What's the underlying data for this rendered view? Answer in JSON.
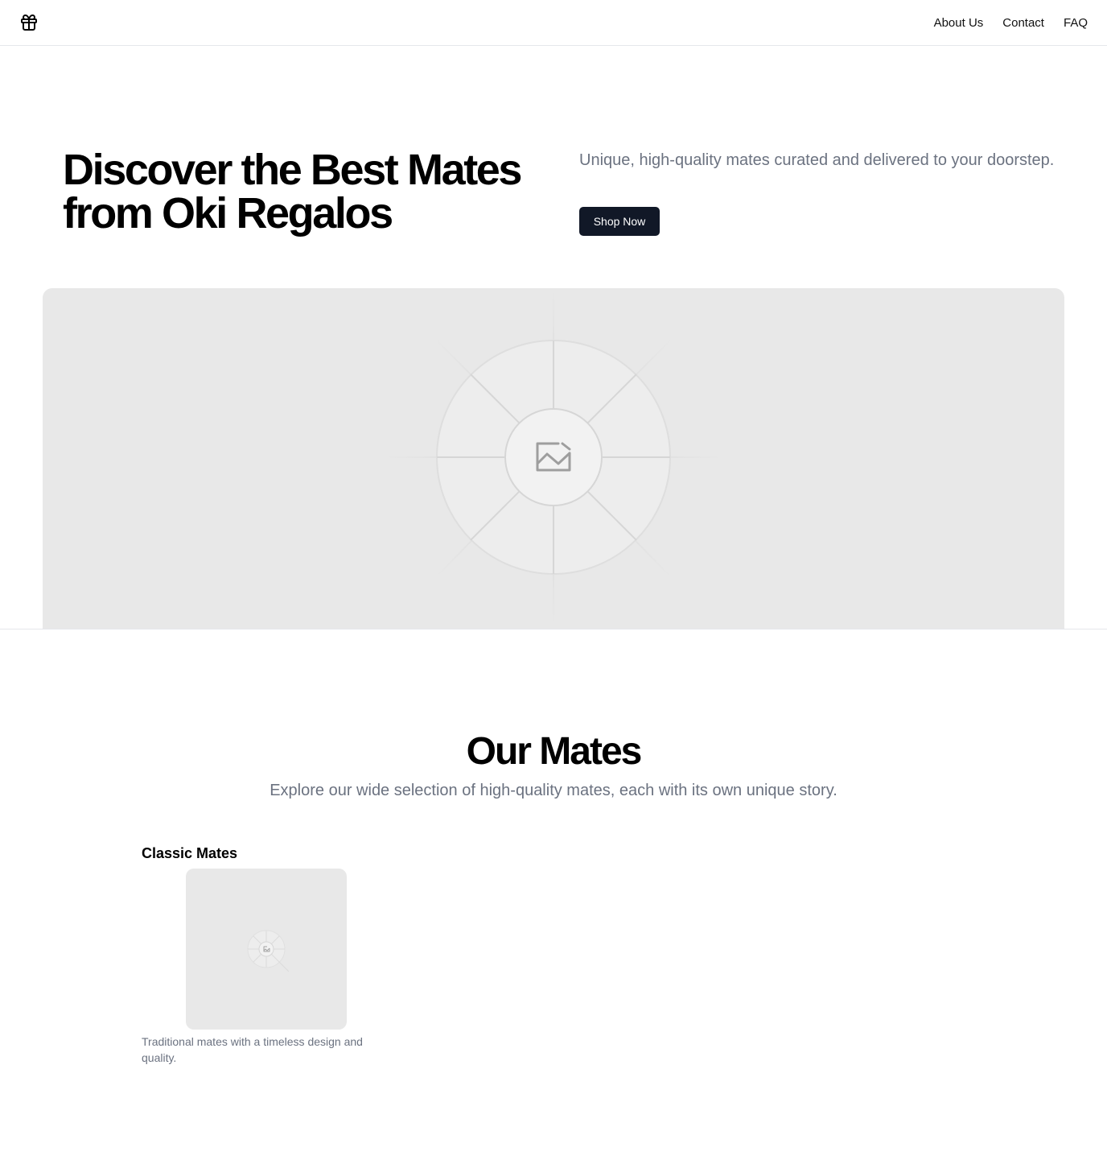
{
  "header": {
    "logo_icon": "gift-icon",
    "nav": [
      {
        "label": "About Us"
      },
      {
        "label": "Contact"
      },
      {
        "label": "FAQ"
      }
    ]
  },
  "hero": {
    "title": "Discover the Best Mates from Oki Regalos",
    "subtitle": "Unique, high-quality mates curated and delivered to your doorstep.",
    "cta_label": "Shop Now",
    "image_icon": "image-placeholder-icon"
  },
  "mates_section": {
    "title": "Our Mates",
    "subtitle": "Explore our wide selection of high-quality mates, each with its own unique story.",
    "categories": [
      {
        "title": "Classic Mates",
        "description": "Traditional mates with a timeless design and quality.",
        "image_icon": "image-placeholder-icon"
      }
    ]
  },
  "colors": {
    "primary_button": "#111827",
    "muted_text": "#6b7280",
    "placeholder_bg": "#e8e8e8",
    "border": "#e5e7eb"
  }
}
